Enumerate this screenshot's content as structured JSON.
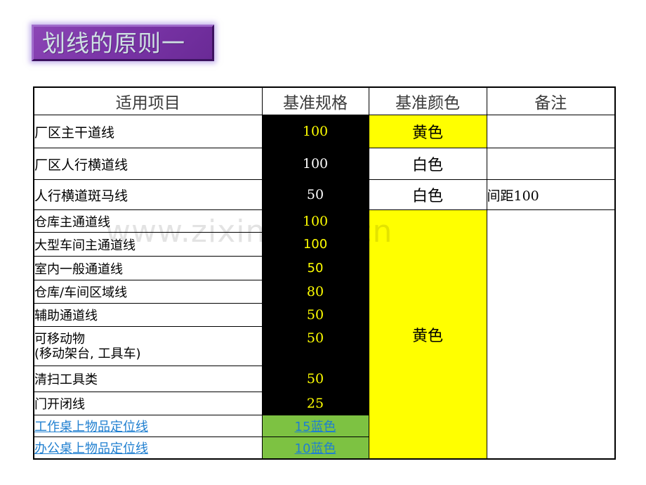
{
  "slide": {
    "title": "划线的原则一",
    "watermark": "www.zixin.com.cn",
    "accent_color": "#7B35A8",
    "title_text_color": "#CFE0E4"
  },
  "table": {
    "headers": {
      "item": "适用项目",
      "spec": "基准规格",
      "color": "基准颜色",
      "note": "备注"
    },
    "colors": {
      "spec_column_bg": "#000000",
      "spec_yellow_text": "#FFFF00",
      "spec_white_text": "#FFFFFF",
      "color_yellow_bg": "#FFFF00",
      "green_bg": "#7DC242",
      "blue_text": "#1F7FD0"
    },
    "rows": [
      {
        "item": "厂区主干道线",
        "spec": "100",
        "color": "黄色",
        "note": ""
      },
      {
        "item": "厂区人行横道线",
        "spec": "100",
        "color": "白色",
        "note": ""
      },
      {
        "item": "人行横道斑马线",
        "spec": "50",
        "color": "白色",
        "note": "间距100"
      },
      {
        "item": "仓库主通道线",
        "spec": "100",
        "color": "",
        "note": ""
      },
      {
        "item": "大型车间主通道线",
        "spec": "100",
        "color": "",
        "note": ""
      },
      {
        "item": "室内一般通道线",
        "spec": "50",
        "color": "",
        "note": ""
      },
      {
        "item": "仓库/车间区域线",
        "spec": "80",
        "color": "",
        "note": ""
      },
      {
        "item": "辅助通道线",
        "spec": "50",
        "color": "",
        "note": ""
      },
      {
        "item": "可移动物",
        "item_line2": "(移动架台, 工具车)",
        "spec": "50",
        "color": "黄色",
        "note": ""
      },
      {
        "item": "清扫工具类",
        "spec": "50",
        "color": "",
        "note": ""
      },
      {
        "item": "门开闭线",
        "spec": "25",
        "color": "",
        "note": ""
      },
      {
        "item": "工作桌上物品定位线",
        "spec": "15蓝色",
        "color": "",
        "note": ""
      },
      {
        "item": "办公桌上物品定位线",
        "spec": "10蓝色",
        "color": "",
        "note": ""
      }
    ]
  }
}
